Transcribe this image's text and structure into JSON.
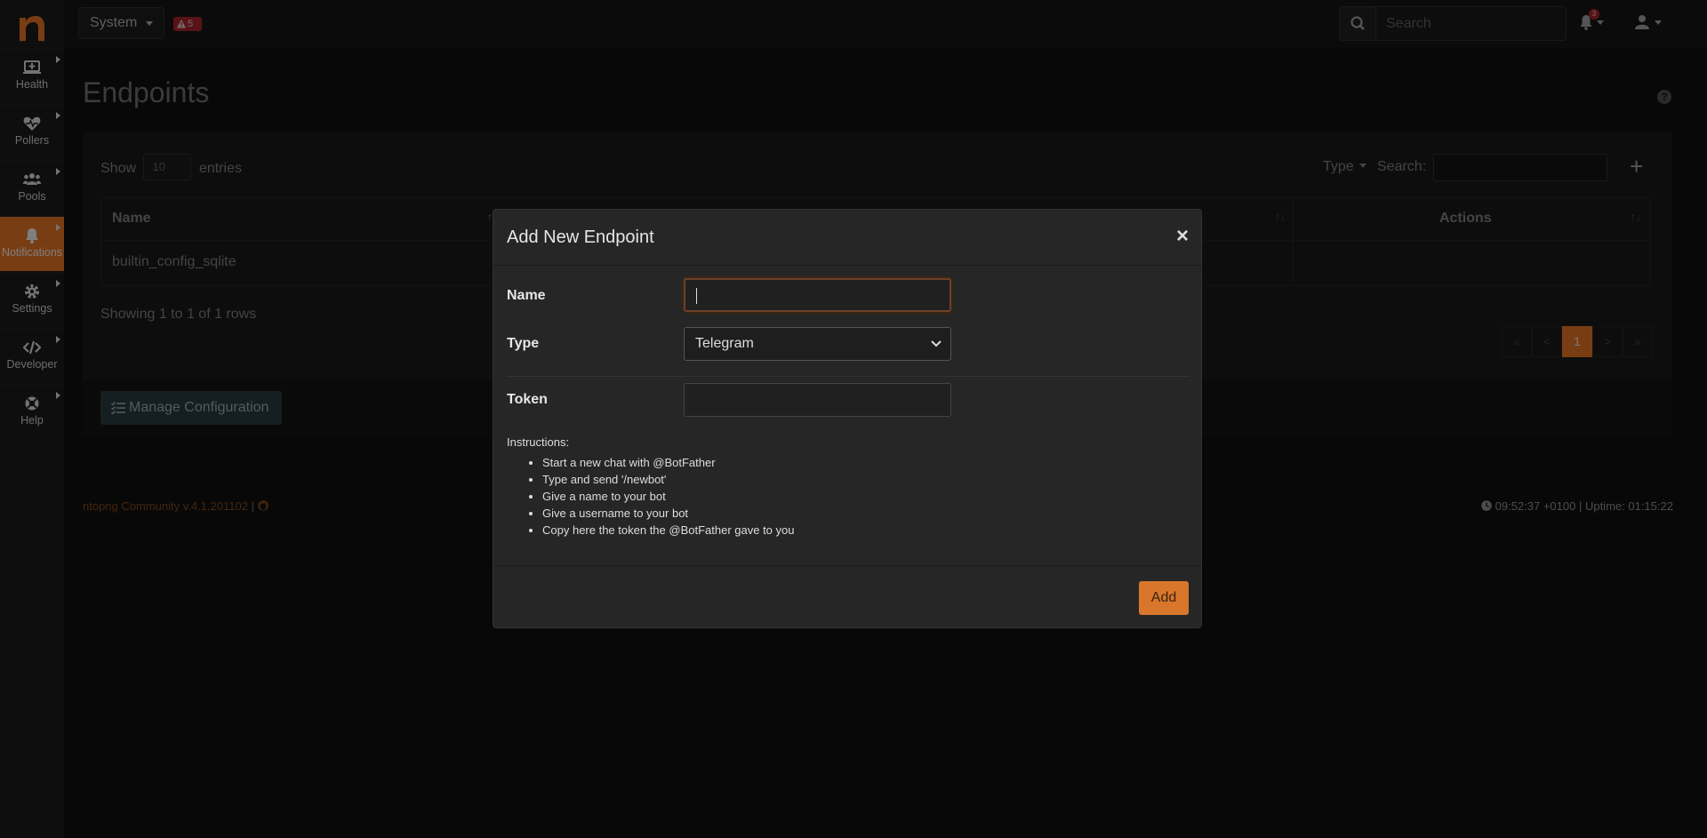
{
  "topbar": {
    "system_label": "System",
    "alert_count": "5",
    "search_placeholder": "Search",
    "notification_count": "3"
  },
  "sidebar": {
    "items": [
      {
        "label": "Health",
        "icon": "monitor-plus-icon"
      },
      {
        "label": "Pollers",
        "icon": "heartbeat-icon"
      },
      {
        "label": "Pools",
        "icon": "users-icon"
      },
      {
        "label": "Notifications",
        "icon": "bell-icon",
        "active": true
      },
      {
        "label": "Settings",
        "icon": "gear-icon"
      },
      {
        "label": "Developer",
        "icon": "code-icon"
      },
      {
        "label": "Help",
        "icon": "lifebuoy-icon"
      }
    ]
  },
  "page": {
    "title": "Endpoints",
    "show_label": "Show",
    "entries_value": "10",
    "entries_label": "entries",
    "type_filter": "Type",
    "search_label": "Search:",
    "table": {
      "columns": [
        "Name",
        "Actions"
      ],
      "rows": [
        [
          "builtin_config_sqlite",
          ""
        ]
      ]
    },
    "showing_text": "Showing 1 to 1 of 1 rows",
    "pager": [
      "«",
      "<",
      "1",
      ">",
      "»"
    ],
    "manage_button": "Manage Configuration"
  },
  "footer": {
    "version": "ntopng Community v.4.1.201102",
    "separator": "|",
    "status": "09:52:37 +0100 | Uptime: 01:15:22"
  },
  "modal": {
    "title": "Add New Endpoint",
    "close": "×",
    "name_label": "Name",
    "name_value": "",
    "type_label": "Type",
    "type_value": "Telegram",
    "token_label": "Token",
    "token_value": "",
    "instructions_title": "Instructions:",
    "instructions": [
      "Start a new chat with @BotFather",
      "Type and send '/newbot'",
      "Give a name to your bot",
      "Give a username to your bot",
      "Copy here the token the @BotFather gave to you"
    ],
    "add_button": "Add"
  },
  "colors": {
    "accent": "#f37b26",
    "badge": "#b3262e"
  }
}
